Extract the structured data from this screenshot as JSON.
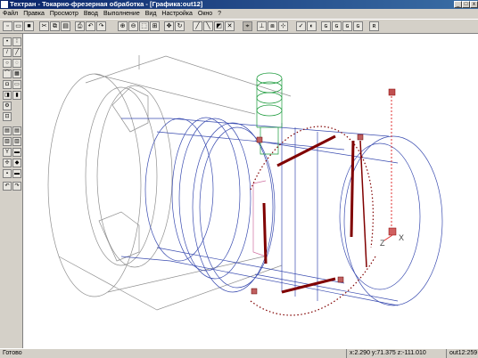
{
  "window": {
    "title": "Техтран - Токарно-фрезерная обработка - [Графика:out12]",
    "controls": {
      "minimize": "_",
      "maximize": "□",
      "close": "x"
    }
  },
  "menu": [
    "Файл",
    "Правка",
    "Просмотр",
    "Ввод",
    "Выполнение",
    "Вид",
    "Настройка",
    "Окно",
    "?"
  ],
  "toolbar": {
    "icons": [
      "new-icon",
      "open-icon",
      "save-icon",
      "cut-icon",
      "copy-icon",
      "paste-icon",
      "print-icon",
      "undo-icon",
      "redo-icon",
      "zoom-in-icon",
      "zoom-out-icon",
      "zoom-window-icon",
      "zoom-all-icon",
      "pan-icon",
      "refresh-icon",
      "view-front-icon",
      "view-top-icon",
      "view-iso-icon",
      "tool-path-icon",
      "measure-icon",
      "axis-icon",
      "layers-icon",
      "grid-icon",
      "wire-icon",
      "shade-icon"
    ]
  },
  "left_toolbar": {
    "icons": [
      "select-icon",
      "point-icon",
      "line-icon",
      "circle-icon",
      "arc-icon",
      "contour-icon",
      "spline-icon",
      "text-icon",
      "surface-icon",
      "solid-icon",
      "tool-icon",
      "machine-icon",
      "filter-icon",
      "chart-icon",
      "fixture-icon",
      "coordinate-icon",
      "undo-icon",
      "redo-icon"
    ]
  },
  "status": {
    "ready": "Готово",
    "coords": "x:2.290 y:71.375 z:-111.010",
    "file": "out12:259"
  },
  "axes": {
    "x_label": "X",
    "z_label": "Z"
  },
  "colors": {
    "title_start": "#0a246a",
    "title_end": "#3a6ea5",
    "part_wire": "#3a4cb0",
    "stock_wire": "#888888",
    "tool_wire": "#1a9a3a",
    "toolpath": "#800000",
    "axis_red": "#e03030"
  }
}
